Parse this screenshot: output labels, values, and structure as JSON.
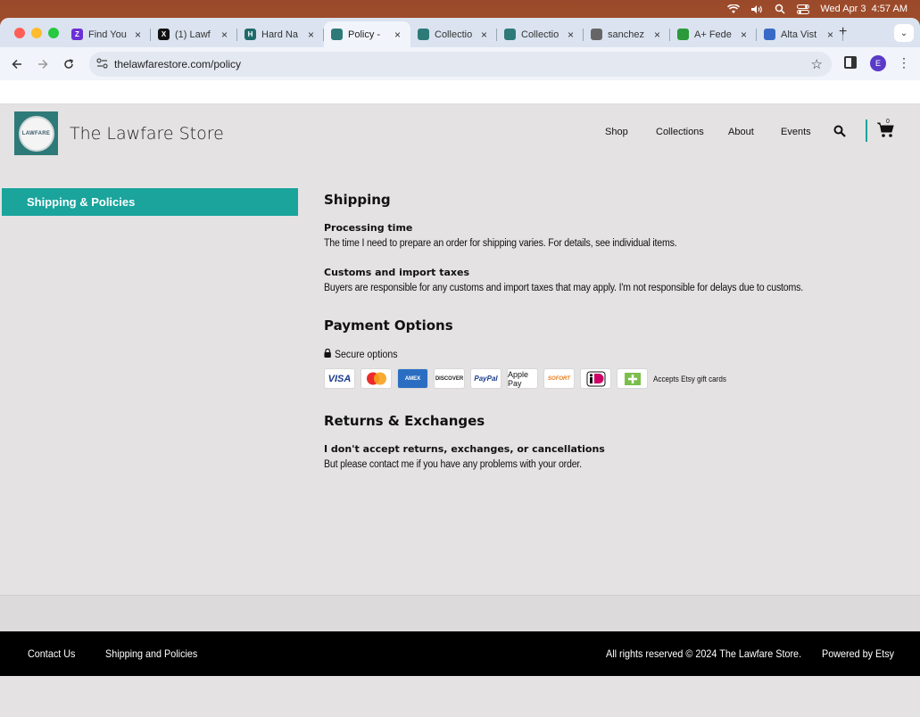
{
  "menubar": {
    "datetime": "Wed Apr 3  4:57 AM",
    "icons": [
      "wifi-icon",
      "volume-icon",
      "spotlight-icon",
      "control-center-icon"
    ]
  },
  "browser": {
    "tabs": [
      {
        "title": "Find You",
        "favicon_color": "#6b2fd6",
        "favicon": "Z"
      },
      {
        "title": "(1) Lawf",
        "favicon_color": "#111111",
        "favicon": "X"
      },
      {
        "title": "Hard Na",
        "favicon_color": "#1f6b6b",
        "favicon": "H"
      },
      {
        "title": "Policy -",
        "favicon_color": "#2e7a78",
        "favicon": "",
        "active": true
      },
      {
        "title": "Collectio",
        "favicon_color": "#2e7a78",
        "favicon": ""
      },
      {
        "title": "Collectio",
        "favicon_color": "#2e7a78",
        "favicon": ""
      },
      {
        "title": "sanchez",
        "favicon_color": "#666666",
        "favicon": ""
      },
      {
        "title": "A+ Fede",
        "favicon_color": "#2a9a3a",
        "favicon": ""
      },
      {
        "title": "Alta Vist",
        "favicon_color": "#3a6ac8",
        "favicon": ""
      }
    ],
    "new_tab": "+",
    "url": "thelawfarestore.com/policy",
    "profile_initial": "E"
  },
  "site": {
    "logo_text": "LAWFARE",
    "store_name": "The Lawfare Store",
    "nav": [
      "Shop",
      "Collections",
      "About",
      "Events"
    ],
    "cart_count": "0",
    "accent": "#1aa49c"
  },
  "sidebar": {
    "active_item": "Shipping & Policies"
  },
  "policy": {
    "shipping_heading": "Shipping",
    "processing_heading": "Processing time",
    "processing_text": "The time I need to prepare an order for shipping varies. For details, see individual items.",
    "customs_heading": "Customs and import taxes",
    "customs_text": "Buyers are responsible for any customs and import taxes that may apply. I'm not responsible for delays due to customs.",
    "payment_heading": "Payment Options",
    "secure_label": "Secure options",
    "payment_methods": [
      "VISA",
      "mastercard",
      "AMEX",
      "DISCOVER",
      "PayPal",
      "Apple Pay",
      "SOFORT",
      "iDEAL",
      "gift"
    ],
    "giftcard_label": "Accepts Etsy gift cards",
    "returns_heading": "Returns & Exchanges",
    "returns_subheading": "I don't accept returns, exchanges, or cancellations",
    "returns_text": "But please contact me if you have any problems with your order."
  },
  "footer": {
    "contact": "Contact Us",
    "shipping": "Shipping and Policies",
    "copyright": "All rights reserved © 2024 The Lawfare Store.",
    "powered": "Powered by Etsy"
  }
}
